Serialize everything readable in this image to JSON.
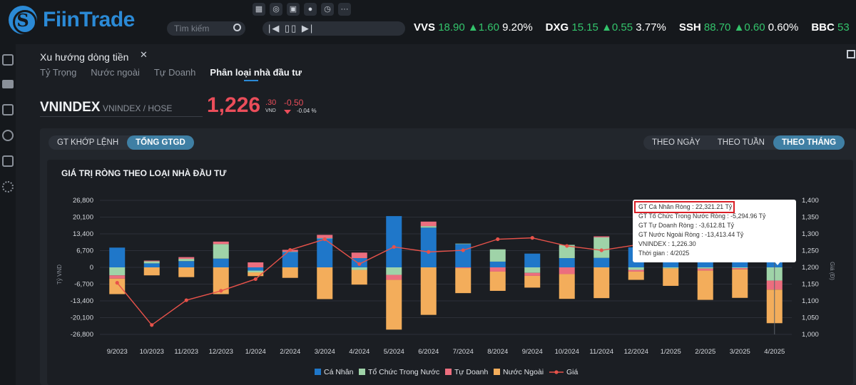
{
  "app": {
    "logo_text": "FiinTrade"
  },
  "toolbar": {
    "icons": [
      "table-icon",
      "search-zoom-icon",
      "gift-icon",
      "dot-icon",
      "clock-icon",
      "more-icon"
    ]
  },
  "search": {
    "placeholder": "Tìm kiếm"
  },
  "media": {
    "label": "|◀ ▯▯ ▶|"
  },
  "ticker": [
    {
      "symbol": "VVS",
      "price": "18.90",
      "change": "▲1.60",
      "pct": "9.20%"
    },
    {
      "symbol": "DXG",
      "price": "15.15",
      "change": "▲0.55",
      "pct": "3.77%"
    },
    {
      "symbol": "SSH",
      "price": "88.70",
      "change": "▲0.60",
      "pct": "0.60%"
    },
    {
      "symbol": "BBC",
      "price": "53",
      "change": "",
      "pct": ""
    }
  ],
  "panel": {
    "title": "Xu hướng dòng tiền",
    "close": "✕",
    "tabs": [
      "Tỷ Trọng",
      "Nước ngoài",
      "Tự Doanh",
      "Phân loại nhà đầu tư"
    ],
    "active_tab": 3
  },
  "index": {
    "name": "VNINDEX",
    "sub": "VNINDEX / HOSE",
    "value": "1,226",
    "decimal": ".30",
    "unit": "VND",
    "change": "-0.50",
    "pct": "-0.04 %"
  },
  "toggles": {
    "left": [
      "GT KHỚP LỆNH",
      "TỔNG GTGD"
    ],
    "left_active": 1,
    "right": [
      "THEO NGÀY",
      "THEO TUẦN",
      "THEO THÁNG"
    ],
    "right_active": 2
  },
  "chart_title": "GIÁ TRỊ RÒNG THEO LOẠI NHÀ ĐẦU TƯ",
  "colors": {
    "ca_nhan": "#1f77c9",
    "to_chuc": "#9fd3a8",
    "tu_doanh": "#ec6e7e",
    "nuoc_ngoai": "#f3ad5b",
    "gia": "#e8524a",
    "down": "#ea4d5a",
    "up": "#33c36b"
  },
  "tooltip": {
    "lines": [
      "GT Cá Nhân Ròng  : 22,321.21 Tỷ",
      "GT Tổ Chức Trong Nước Ròng : -5,294.96 Tỷ",
      "GT Tự Doanh Ròng : -3,612.81 Tỷ",
      "GT Nước Ngoài Ròng : -13,413.44 Tỷ",
      "VNINDEX : 1,226.30",
      "Thời gian : 4/2025"
    ]
  },
  "chart_data": {
    "type": "bar",
    "title": "GIÁ TRỊ RÒNG THEO LOẠI NHÀ ĐẦU TƯ",
    "ylabel": "Tỷ VND",
    "y2label": "Giá (Đ)",
    "ylim": [
      -26800,
      26800
    ],
    "y2lim": [
      1000,
      1400
    ],
    "yticks": [
      "26,800",
      "20,100",
      "13,400",
      "6,700",
      "0",
      "-6,700",
      "-13,400",
      "-20,100",
      "-26,800"
    ],
    "y2ticks": [
      "1,400",
      "1,350",
      "1,300",
      "1,250",
      "1,200",
      "1,150",
      "1,100",
      "1,050",
      "1,000"
    ],
    "stacked": true,
    "legend_position": "bottom",
    "categories": [
      "9/2023",
      "10/2023",
      "11/2023",
      "12/2023",
      "1/2024",
      "2/2024",
      "3/2024",
      "4/2024",
      "5/2024",
      "6/2024",
      "7/2024",
      "8/2024",
      "9/2024",
      "10/2024",
      "11/2024",
      "12/2024",
      "1/2025",
      "2/2025",
      "3/2025",
      "4/2025"
    ],
    "series": [
      {
        "name": "Cá Nhân",
        "values": [
          7900,
          1600,
          2500,
          3500,
          -1300,
          6200,
          11600,
          3700,
          20500,
          15900,
          9300,
          2300,
          5500,
          3700,
          3800,
          8000,
          5500,
          3300,
          3000,
          22321
        ]
      },
      {
        "name": "Tổ Chức Trong Nước",
        "values": [
          -3200,
          800,
          900,
          5800,
          -700,
          100,
          100,
          -1000,
          -3000,
          600,
          200,
          4900,
          -2200,
          5300,
          8200,
          -1000,
          -400,
          -500,
          -300,
          -5295
        ]
      },
      {
        "name": "Tự Doanh",
        "values": [
          -1300,
          300,
          700,
          1000,
          2000,
          700,
          1300,
          2200,
          -2000,
          1800,
          -300,
          -1700,
          -1200,
          -2700,
          400,
          -700,
          200,
          -800,
          -500,
          -3613
        ]
      },
      {
        "name": "Nước Ngoài",
        "values": [
          -6200,
          -3200,
          -3900,
          -10700,
          -1500,
          -4200,
          -12700,
          -5900,
          -19900,
          -19000,
          -10000,
          -7700,
          -4700,
          -9900,
          -12300,
          -3300,
          -7000,
          -11700,
          -11400,
          -13413
        ]
      }
    ],
    "line": {
      "name": "Giá",
      "values": [
        1154,
        1028,
        1102,
        1130,
        1165,
        1252,
        1284,
        1210,
        1261,
        1246,
        1251,
        1284,
        1288,
        1264,
        1251,
        1267,
        1266,
        1310,
        1306,
        1226
      ]
    },
    "tooltip_index": 19
  }
}
